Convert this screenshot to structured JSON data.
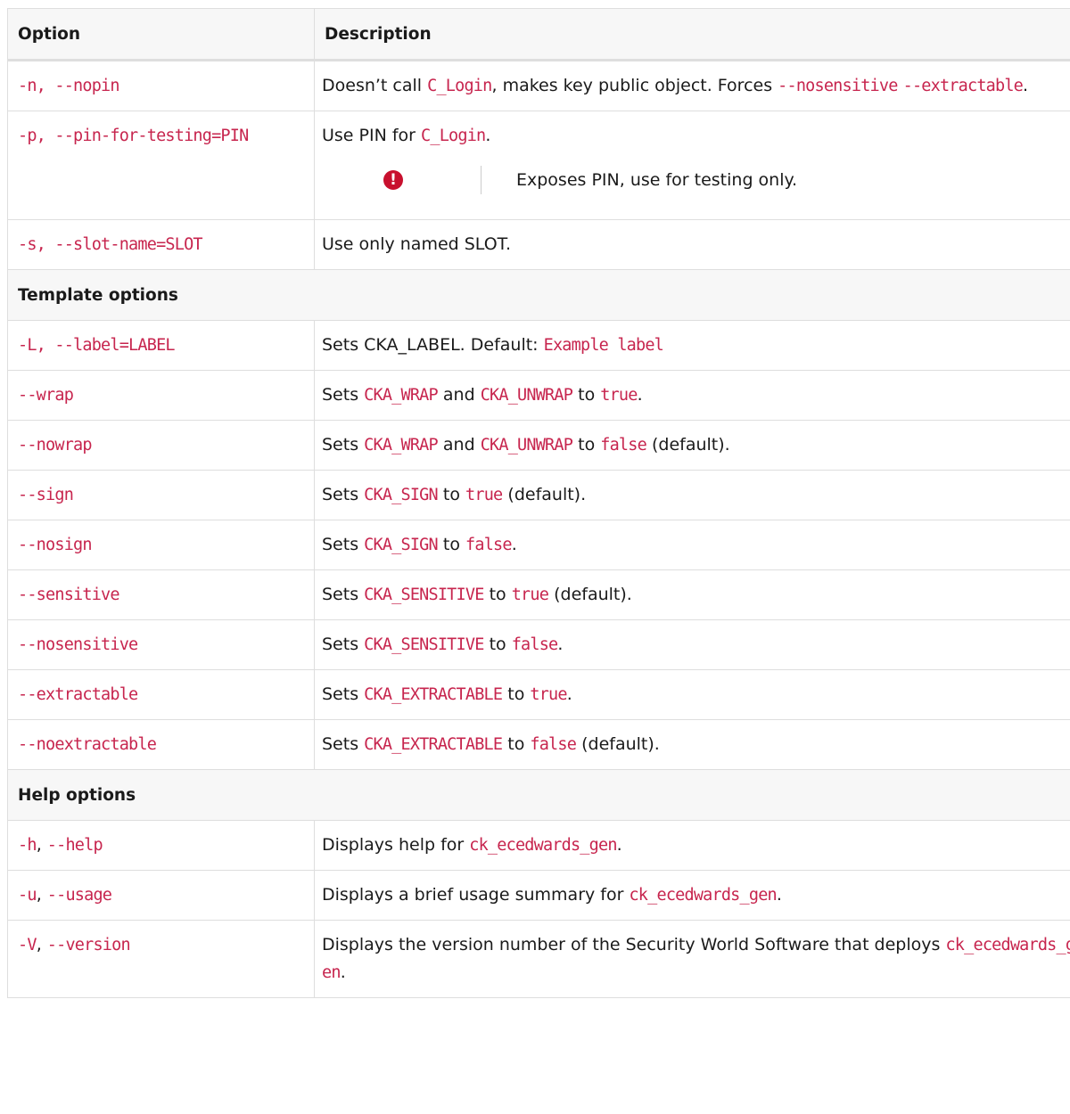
{
  "table": {
    "headers": {
      "option": "Option",
      "description": "Description"
    },
    "rows_connection": [
      {
        "option": "-n, --nopin",
        "desc": [
          {
            "t": "Doesn’t call "
          },
          {
            "c": "C_Login"
          },
          {
            "t": ", makes key public object. Forces "
          },
          {
            "c": "--nosensitive"
          },
          {
            "t": " "
          },
          {
            "c": "--extractable"
          },
          {
            "t": "."
          }
        ]
      },
      {
        "option": "-p, --pin-for-testing=PIN",
        "desc": [
          {
            "t": "Use PIN for "
          },
          {
            "c": "C_Login"
          },
          {
            "t": "."
          }
        ],
        "note": {
          "icon": "exclamation-circle-icon",
          "glyph": "!",
          "text": "Exposes PIN, use for testing only.",
          "color": "#c8102e"
        }
      },
      {
        "option": "-s, --slot-name=SLOT",
        "desc": [
          {
            "t": "Use only named SLOT."
          }
        ]
      }
    ],
    "section_template": "Template options",
    "rows_template": [
      {
        "option": "-L, --label=LABEL",
        "desc": [
          {
            "t": "Sets CKA_LABEL. Default: "
          },
          {
            "c": "Example label"
          }
        ]
      },
      {
        "option": "--wrap",
        "desc": [
          {
            "t": "Sets "
          },
          {
            "c": "CKA_WRAP"
          },
          {
            "t": " and "
          },
          {
            "c": "CKA_UNWRAP"
          },
          {
            "t": " to "
          },
          {
            "c": "true"
          },
          {
            "t": "."
          }
        ]
      },
      {
        "option": "--nowrap",
        "desc": [
          {
            "t": "Sets "
          },
          {
            "c": "CKA_WRAP"
          },
          {
            "t": " and "
          },
          {
            "c": "CKA_UNWRAP"
          },
          {
            "t": " to "
          },
          {
            "c": "false"
          },
          {
            "t": " (default)."
          }
        ]
      },
      {
        "option": "--sign",
        "desc": [
          {
            "t": "Sets "
          },
          {
            "c": "CKA_SIGN"
          },
          {
            "t": " to "
          },
          {
            "c": "true"
          },
          {
            "t": " (default)."
          }
        ]
      },
      {
        "option": "--nosign",
        "desc": [
          {
            "t": "Sets "
          },
          {
            "c": "CKA_SIGN"
          },
          {
            "t": " to "
          },
          {
            "c": "false"
          },
          {
            "t": "."
          }
        ]
      },
      {
        "option": "--sensitive",
        "desc": [
          {
            "t": "Sets "
          },
          {
            "c": "CKA_SENSITIVE"
          },
          {
            "t": " to "
          },
          {
            "c": "true"
          },
          {
            "t": " (default)."
          }
        ]
      },
      {
        "option": "--nosensitive",
        "desc": [
          {
            "t": "Sets "
          },
          {
            "c": "CKA_SENSITIVE"
          },
          {
            "t": " to "
          },
          {
            "c": "false"
          },
          {
            "t": "."
          }
        ]
      },
      {
        "option": "--extractable",
        "desc": [
          {
            "t": "Sets "
          },
          {
            "c": "CKA_EXTRACTABLE"
          },
          {
            "t": " to "
          },
          {
            "c": "true"
          },
          {
            "t": "."
          }
        ]
      },
      {
        "option": "--noextractable",
        "desc": [
          {
            "t": "Sets "
          },
          {
            "c": "CKA_EXTRACTABLE"
          },
          {
            "t": " to "
          },
          {
            "c": "false"
          },
          {
            "t": " (default)."
          }
        ]
      }
    ],
    "section_help": "Help options",
    "rows_help": [
      {
        "option_parts": [
          {
            "c": "-h"
          },
          {
            "t": ", "
          },
          {
            "c": "--help"
          }
        ],
        "desc": [
          {
            "t": "Displays help for "
          },
          {
            "c": "ck_ecedwards_gen"
          },
          {
            "t": "."
          }
        ]
      },
      {
        "option_parts": [
          {
            "c": "-u"
          },
          {
            "t": ", "
          },
          {
            "c": "--usage"
          }
        ],
        "desc": [
          {
            "t": "Displays a brief usage summary for "
          },
          {
            "c": "ck_ecedwards_gen"
          },
          {
            "t": "."
          }
        ]
      },
      {
        "option_parts": [
          {
            "c": "-V"
          },
          {
            "t": ", "
          },
          {
            "c": "--version"
          }
        ],
        "desc": [
          {
            "t": "Displays the version number of the Security World Software that deploys "
          },
          {
            "c": "ck_ecedwards_gen"
          },
          {
            "t": "."
          }
        ]
      }
    ]
  }
}
